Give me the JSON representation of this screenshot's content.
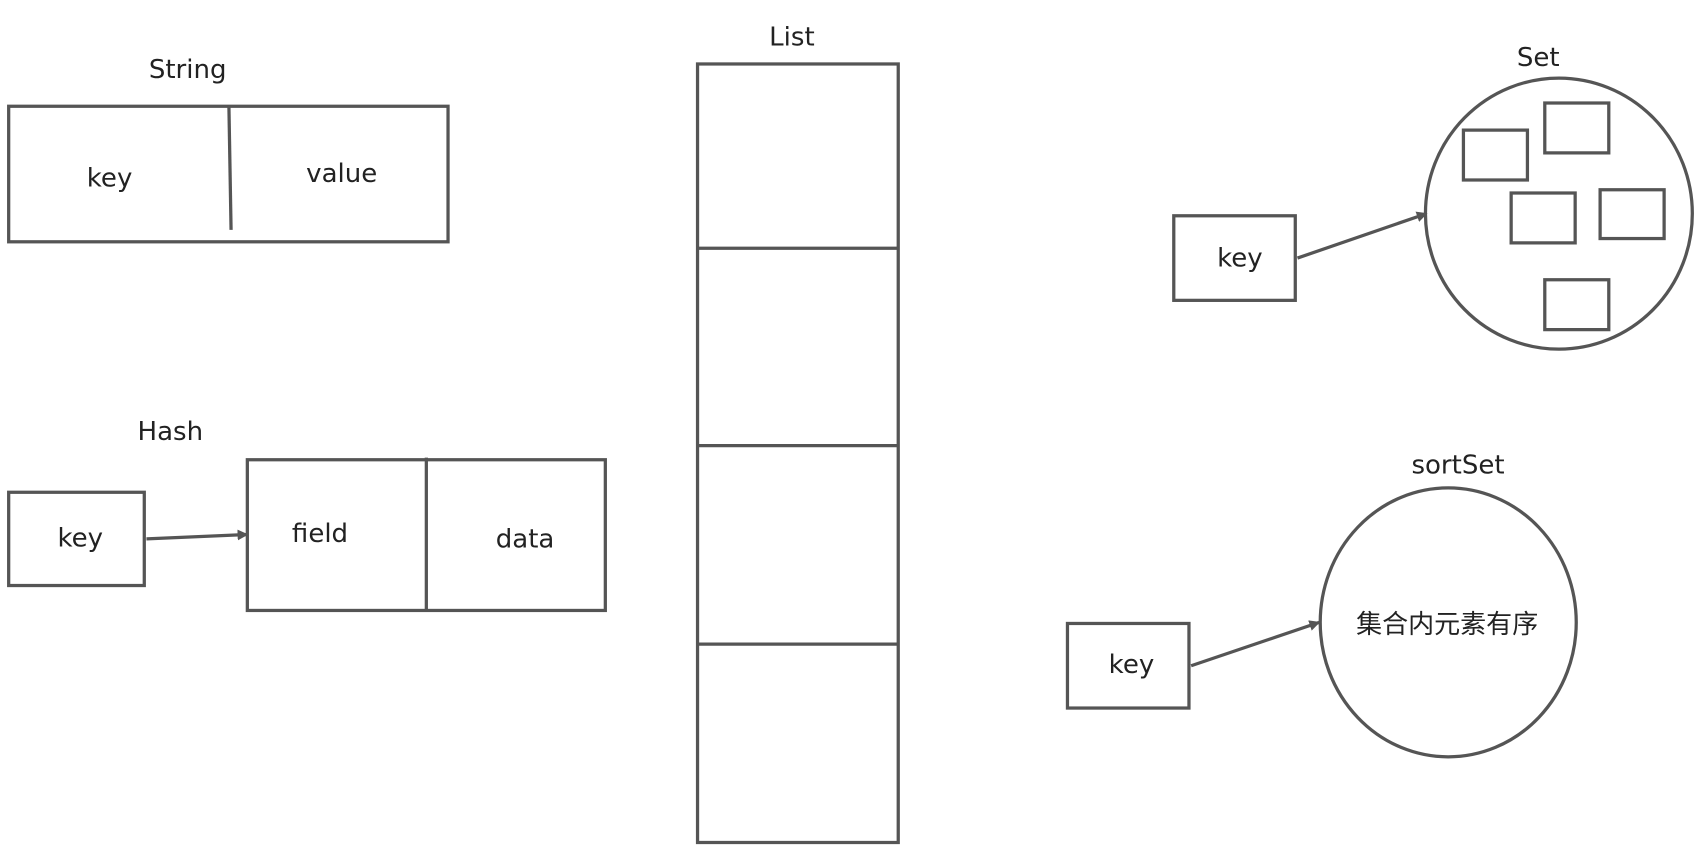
{
  "colors": {
    "stroke": "#555555",
    "text": "#222222",
    "background": "#ffffff"
  },
  "string": {
    "title": "String",
    "key": "key",
    "value": "value"
  },
  "list": {
    "title": "List"
  },
  "set": {
    "title": "Set",
    "key": "key"
  },
  "hash": {
    "title": "Hash",
    "key": "key",
    "field": "field",
    "data": "data"
  },
  "sortset": {
    "title": "sortSet",
    "key": "key",
    "description": "集合内元素有序"
  }
}
